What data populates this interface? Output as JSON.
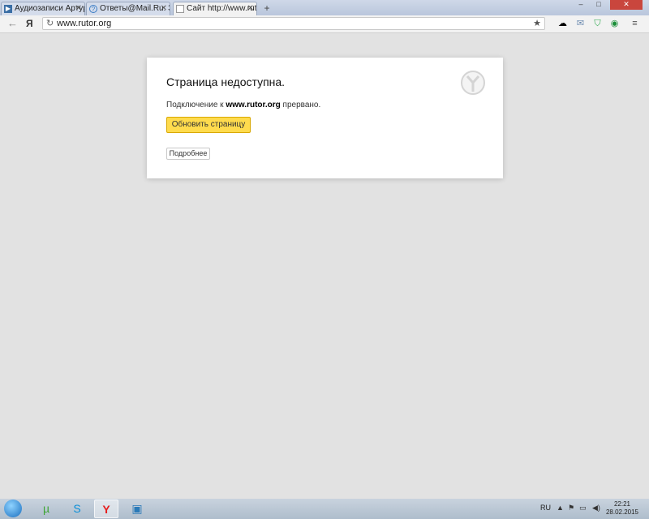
{
  "tabs": [
    {
      "label": "Аудиозаписи Артура",
      "icon": "play-icon"
    },
    {
      "label": "Ответы@Mail.Ru: Зад",
      "icon": "answers-icon"
    },
    {
      "label": "Сайт http://www.ruto",
      "icon": "page-icon"
    }
  ],
  "window_controls": {
    "minimize": "–",
    "maximize": "□",
    "close": "✕"
  },
  "toolbar": {
    "back": "←",
    "browser_logo": "Я",
    "url": "www.rutor.org",
    "star": "★"
  },
  "error": {
    "title": "Страница недоступна.",
    "message_prefix": "Подключение к ",
    "message_host": "www.rutor.org",
    "message_suffix": " прервано.",
    "refresh_button": "Обновить страницу",
    "details_button": "Подробнее"
  },
  "taskbar": {
    "apps": [
      "utorrent-icon",
      "skype-icon",
      "yandex-browser-icon",
      "remote-desktop-icon"
    ],
    "language": "RU",
    "time": "22:21",
    "date": "28.02.2015"
  },
  "colors": {
    "accent": "#ffdb4d",
    "page_bg": "#e2e2e2"
  }
}
